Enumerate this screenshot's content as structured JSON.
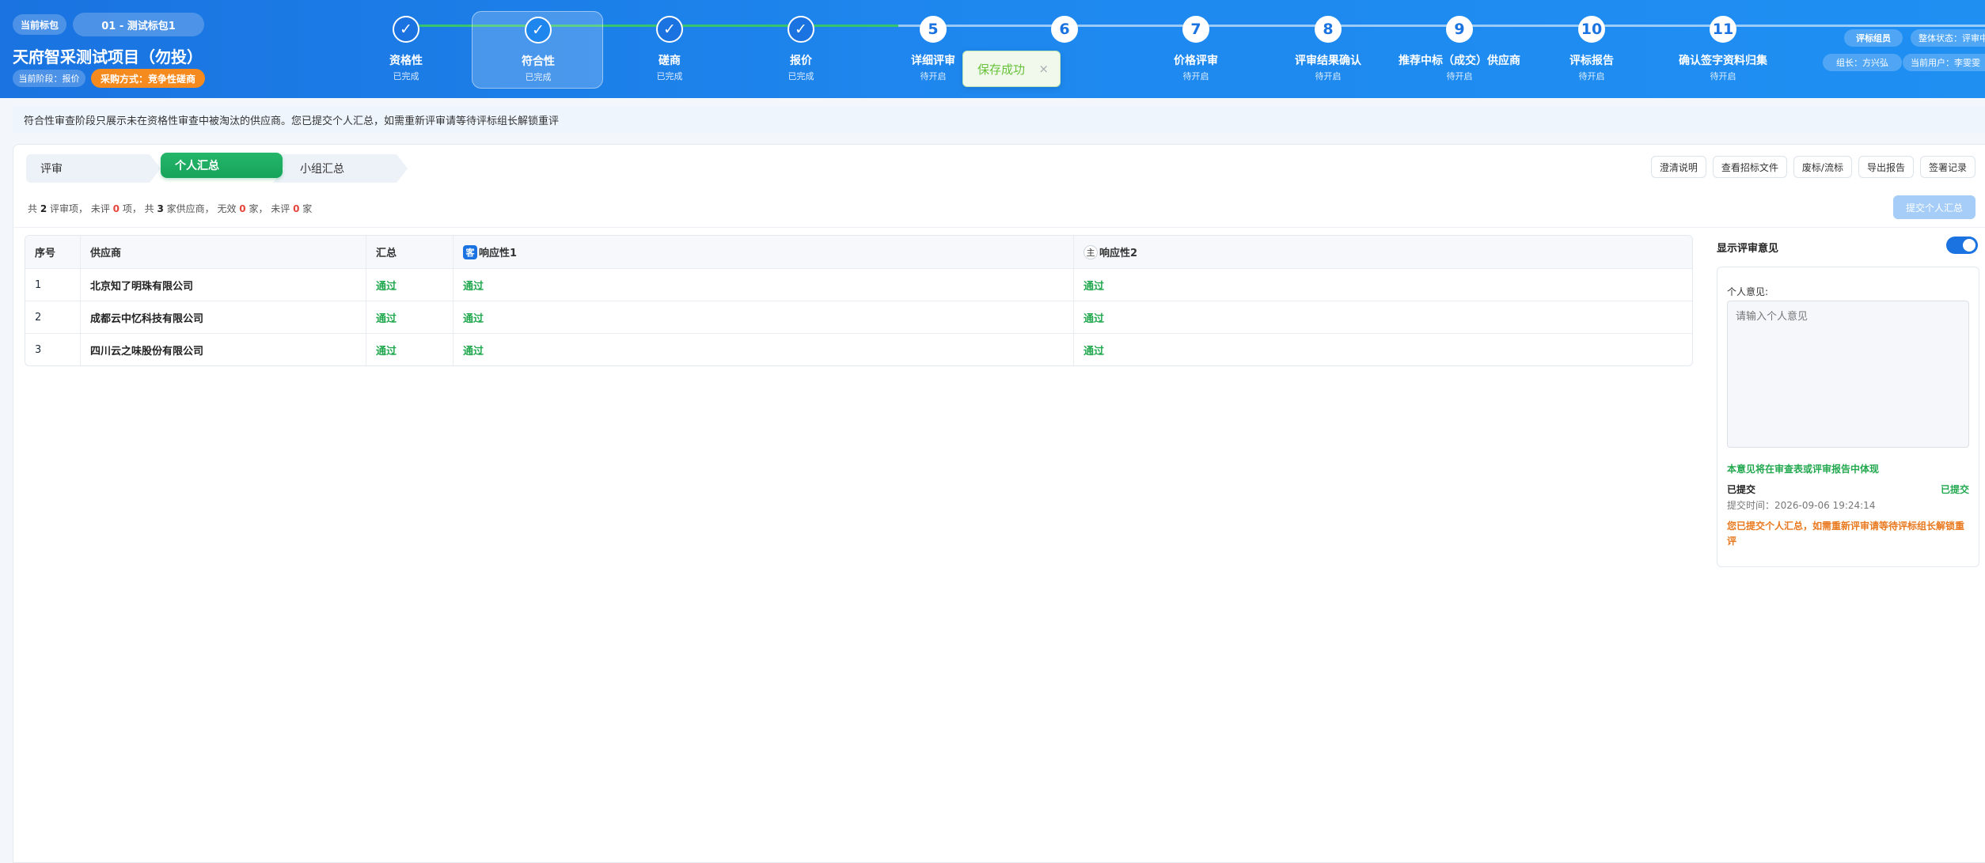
{
  "header": {
    "current_package_label": "当前标包",
    "package_name": "01 - 测试标包1",
    "project_title": "天府智采测试项目（勿投）",
    "stage_label": "当前阶段：报价",
    "method_label": "采购方式：竞争性磋商",
    "role_label": "评标组员",
    "overall_status": "整体状态：评审中",
    "leader": "组长：方兴弘",
    "current_user": "当前用户：李雯雯"
  },
  "steps": [
    {
      "number": "✓",
      "label": "资格性",
      "status": "已完成",
      "state": "done"
    },
    {
      "number": "✓",
      "label": "符合性",
      "status": "已完成",
      "state": "active"
    },
    {
      "number": "✓",
      "label": "磋商",
      "status": "已完成",
      "state": "done"
    },
    {
      "number": "✓",
      "label": "报价",
      "status": "已完成",
      "state": "done"
    },
    {
      "number": "5",
      "label": "详细评审",
      "status": "待开启",
      "state": "pending"
    },
    {
      "number": "6",
      "label": "",
      "status": "",
      "state": "pending"
    },
    {
      "number": "7",
      "label": "价格评审",
      "status": "待开启",
      "state": "pending"
    },
    {
      "number": "8",
      "label": "评审结果确认",
      "status": "待开启",
      "state": "pending"
    },
    {
      "number": "9",
      "label": "推荐中标（成交）供应商",
      "status": "待开启",
      "state": "pending"
    },
    {
      "number": "10",
      "label": "评标报告",
      "status": "待开启",
      "state": "pending"
    },
    {
      "number": "11",
      "label": "确认签字资料归集",
      "status": "待开启",
      "state": "pending"
    }
  ],
  "toast": {
    "message": "保存成功",
    "close": "×"
  },
  "notice": "符合性审查阶段只展示未在资格性审查中被淘汰的供应商。您已提交个人汇总，如需重新评审请等待评标组长解锁重评",
  "tabs": [
    {
      "label": "评审"
    },
    {
      "label": "个人汇总"
    },
    {
      "label": "小组汇总"
    }
  ],
  "toolbar": [
    "澄清说明",
    "查看招标文件",
    "废标/流标",
    "导出报告",
    "签署记录"
  ],
  "summary": {
    "p1": "共 ",
    "items": "2",
    "p2": " 评审项，  未评 ",
    "unrated_items": "0",
    "p3": " 项，  共 ",
    "suppliers": "3",
    "p4": " 家供应商，  无效 ",
    "invalid": "0",
    "p5": " 家，  未评 ",
    "unrated_suppliers": "0",
    "p6": " 家"
  },
  "submit_button": "提交个人汇总",
  "table": {
    "headers": {
      "index": "序号",
      "supplier": "供应商",
      "total": "汇总",
      "col1_tag": "客",
      "col1": "响应性1",
      "col2_tag": "主",
      "col2": "响应性2"
    },
    "rows": [
      {
        "index": "1",
        "supplier": "北京知了明珠有限公司",
        "total": "通过",
        "col1": "通过",
        "col2": "通过"
      },
      {
        "index": "2",
        "supplier": "成都云中忆科技有限公司",
        "total": "通过",
        "col1": "通过",
        "col2": "通过"
      },
      {
        "index": "3",
        "supplier": "四川云之味股份有限公司",
        "total": "通过",
        "col1": "通过",
        "col2": "通过"
      }
    ]
  },
  "side": {
    "title": "显示评审意见",
    "toggle_on": true,
    "opinion_label": "个人意见:",
    "opinion_placeholder": "请输入个人意见",
    "note": "本意见将在审查表或评审报告中体现",
    "submitted": "已提交",
    "submitted_status": "已提交",
    "submit_time": "提交时间：2026-09-06 19:24:14",
    "warning": "您已提交个人汇总，如需重新评审请等待评标组长解锁重评"
  },
  "colors": {
    "primary": "#1a73e0",
    "success": "#22a84f",
    "warning": "#f58a1f",
    "danger": "#e6453c"
  }
}
